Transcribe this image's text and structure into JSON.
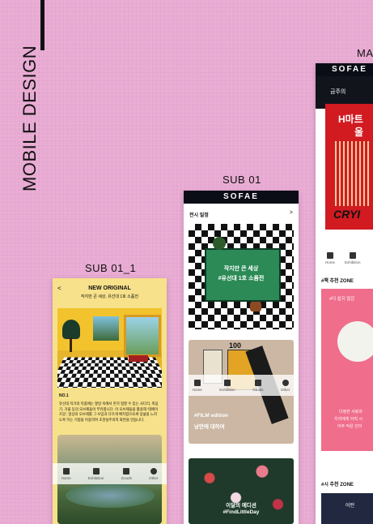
{
  "labels": {
    "side_title": "MOBILE DESIGN",
    "sub01": "SUB 01",
    "sub01_1": "SUB 01_1",
    "main": "MA"
  },
  "brand": "SOFAE",
  "sub01_1": {
    "back": "<",
    "heading": "NEW ORIGINAL",
    "subheading": "작지만 큰 세상, 유선대 1호 소품전",
    "no_label": "NO.1",
    "body": "유선대 작가의 작품에는 옆방 속에서 흔히 접할 수 있는 사다리, 축음기, 거울 등의 오브제들이 부유합니다. 이 오브제들을 활용해 '데페이즈망', 일상의 오브제를 그 쓰임과 다르게 배치함으로써 낯섦을 느끼도록 하는 기법을 이용하여 초현실주의적 화면을 만듭니다."
  },
  "sub01": {
    "section": "전시 일정",
    "chevron": ">",
    "card1_line1": "작지만 큰 세상",
    "card1_line2": "#유선대 1호 소품전",
    "film_brand": "100",
    "film_label": "#FILM edition",
    "film_sub": "낭만에 대하여",
    "card3_line1": "이달의 에디션",
    "card3_line2": "#FindLittleDay"
  },
  "main": {
    "banner_text": "금주의",
    "hero_text1": "H마트",
    "hero_text2": "울",
    "hero_bottom": "CRYI",
    "book_zone": "#책 추천 ZONE",
    "card_pink_title": "#더 쉽지 않은",
    "pink_line1": "다정한 사랑과",
    "pink_line2": "우리에게 아직 시",
    "pink_line3": "아주 작은 선이",
    "poem_zone": "#시 추천 ZONE",
    "dark_card_text": "어떤"
  },
  "nav": {
    "home": "Home",
    "exhibition": "Exhibition",
    "goods": "Goods",
    "other": "Other"
  }
}
